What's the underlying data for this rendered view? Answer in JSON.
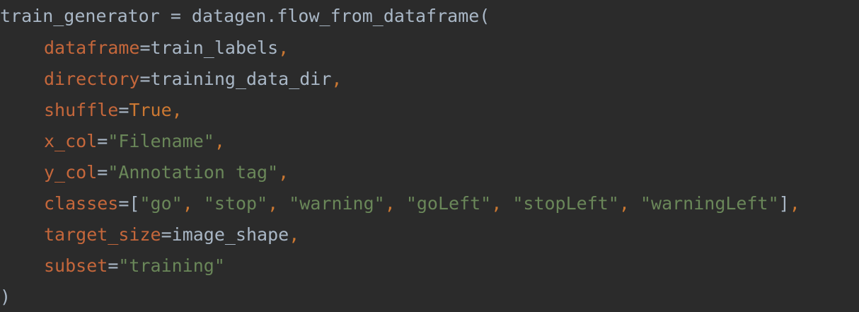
{
  "editor": {
    "background": "#2b2b2b",
    "colors": {
      "default_text": "#a9b7c6",
      "keyword_argument": "#c5673b",
      "keyword": "#cc7832",
      "string": "#6a8759"
    },
    "lines": [
      {
        "text": "train_generator = datagen.flow_from_dataframe("
      },
      {
        "arg": "dataframe",
        "eq": "=",
        "value": "train_labels",
        "comma": ","
      },
      {
        "arg": "directory",
        "eq": "=",
        "value": "training_data_dir",
        "comma": ","
      },
      {
        "arg": "shuffle",
        "eq": "=",
        "value": "True",
        "comma": ","
      },
      {
        "arg": "x_col",
        "eq": "=",
        "value": "\"Filename\"",
        "comma": ","
      },
      {
        "arg": "y_col",
        "eq": "=",
        "value": "\"Annotation tag\"",
        "comma": ","
      },
      {
        "arg": "classes",
        "eq": "=",
        "open": "[",
        "items": [
          "\"go\"",
          "\"stop\"",
          "\"warning\"",
          "\"goLeft\"",
          "\"stopLeft\"",
          "\"warningLeft\""
        ],
        "sep": ", ",
        "close": "]",
        "comma": ","
      },
      {
        "arg": "target_size",
        "eq": "=",
        "value": "image_shape",
        "comma": ","
      },
      {
        "arg": "subset",
        "eq": "=",
        "value": "\"training\""
      },
      {
        "text": ")"
      }
    ]
  }
}
